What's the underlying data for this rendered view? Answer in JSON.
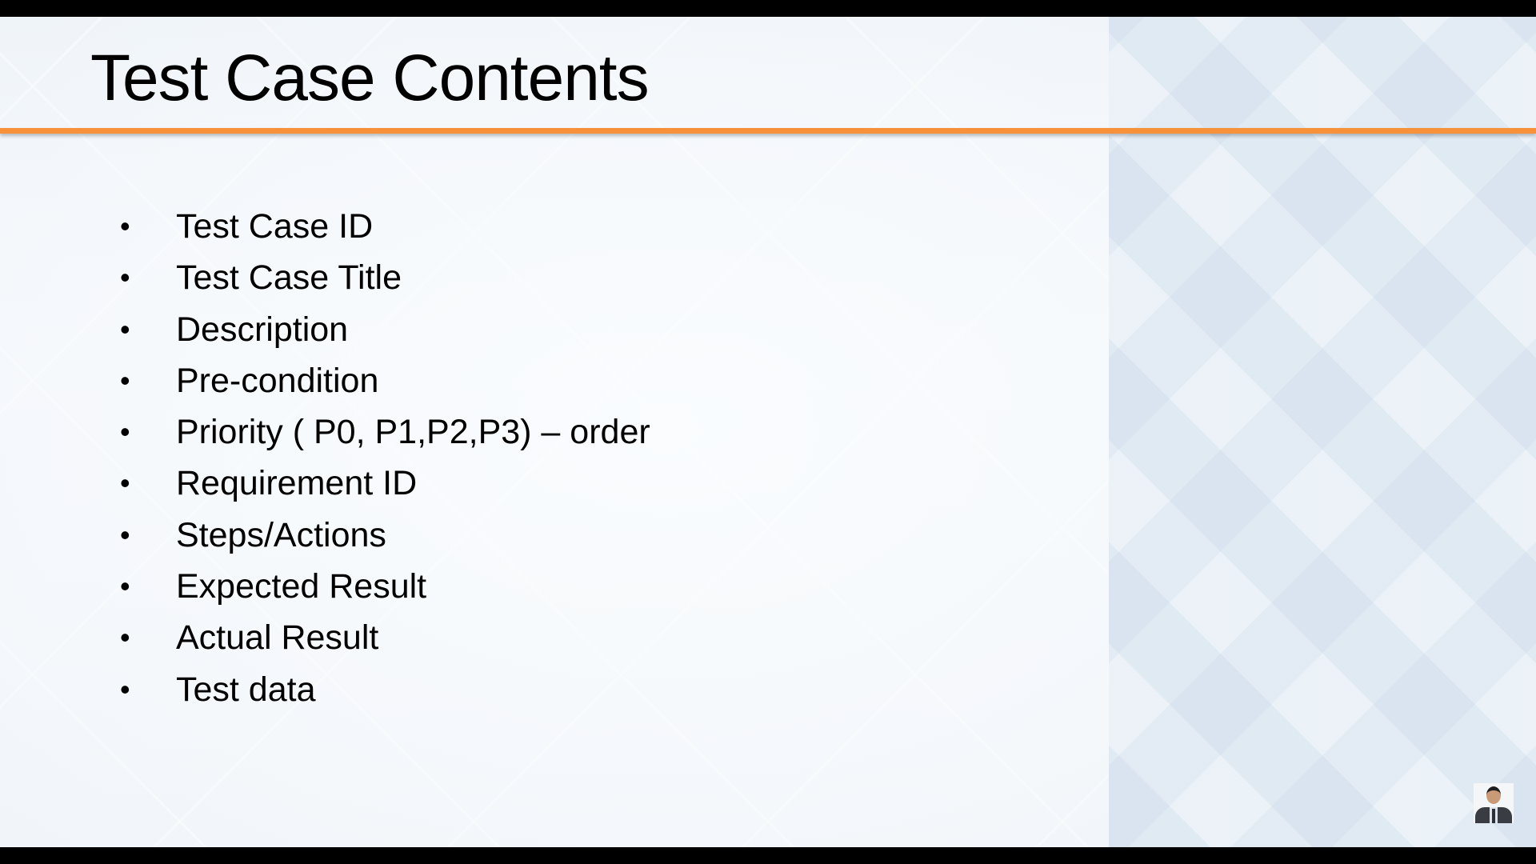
{
  "slide": {
    "title": "Test Case Contents",
    "bullet_glyph": "•",
    "items": [
      "Test Case ID",
      "Test Case Title",
      "Description",
      "Pre-condition",
      "Priority ( P0, P1,P2,P3) – order",
      "Requirement ID",
      "Steps/Actions",
      "Expected Result",
      "Actual Result",
      "Test data"
    ]
  },
  "colors": {
    "accent": "#f7923a",
    "text": "#000000"
  }
}
